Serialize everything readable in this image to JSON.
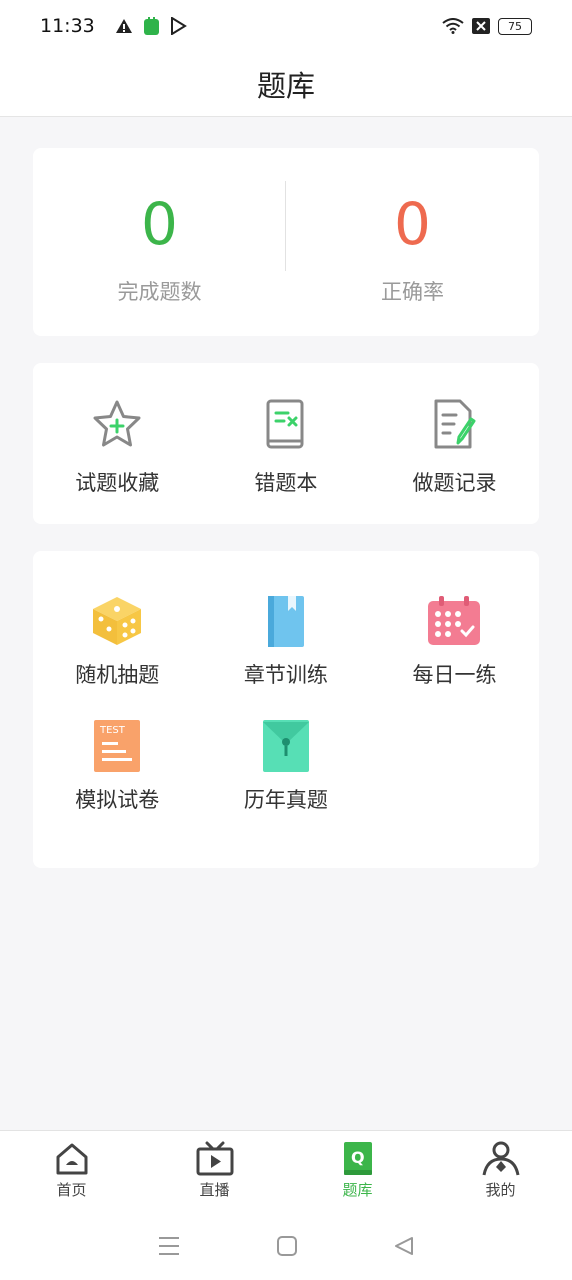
{
  "status": {
    "time": "11:33",
    "battery": "75"
  },
  "header": {
    "title": "题库"
  },
  "stats": {
    "completed_value": "0",
    "completed_label": "完成题数",
    "accuracy_value": "0",
    "accuracy_label": "正确率",
    "completed_color": "#3cb54a",
    "accuracy_color": "#ee6a4f"
  },
  "tools": [
    {
      "label": "试题收藏",
      "icon": "star-plus-icon"
    },
    {
      "label": "错题本",
      "icon": "wrong-book-icon"
    },
    {
      "label": "做题记录",
      "icon": "record-icon"
    }
  ],
  "practice": [
    {
      "label": "随机抽题",
      "icon": "dice-icon",
      "color": "#f7c745"
    },
    {
      "label": "章节训练",
      "icon": "book-icon",
      "color": "#6fc4ee"
    },
    {
      "label": "每日一练",
      "icon": "calendar-icon",
      "color": "#f37c92"
    },
    {
      "label": "模拟试卷",
      "icon": "test-paper-icon",
      "color": "#f9a26a",
      "badge": "TEST"
    },
    {
      "label": "历年真题",
      "icon": "envelope-icon",
      "color": "#57dfb5"
    }
  ],
  "tabs": [
    {
      "label": "首页",
      "icon": "home-icon"
    },
    {
      "label": "直播",
      "icon": "tv-icon"
    },
    {
      "label": "题库",
      "icon": "question-bank-icon",
      "active": true
    },
    {
      "label": "我的",
      "icon": "user-icon"
    }
  ]
}
